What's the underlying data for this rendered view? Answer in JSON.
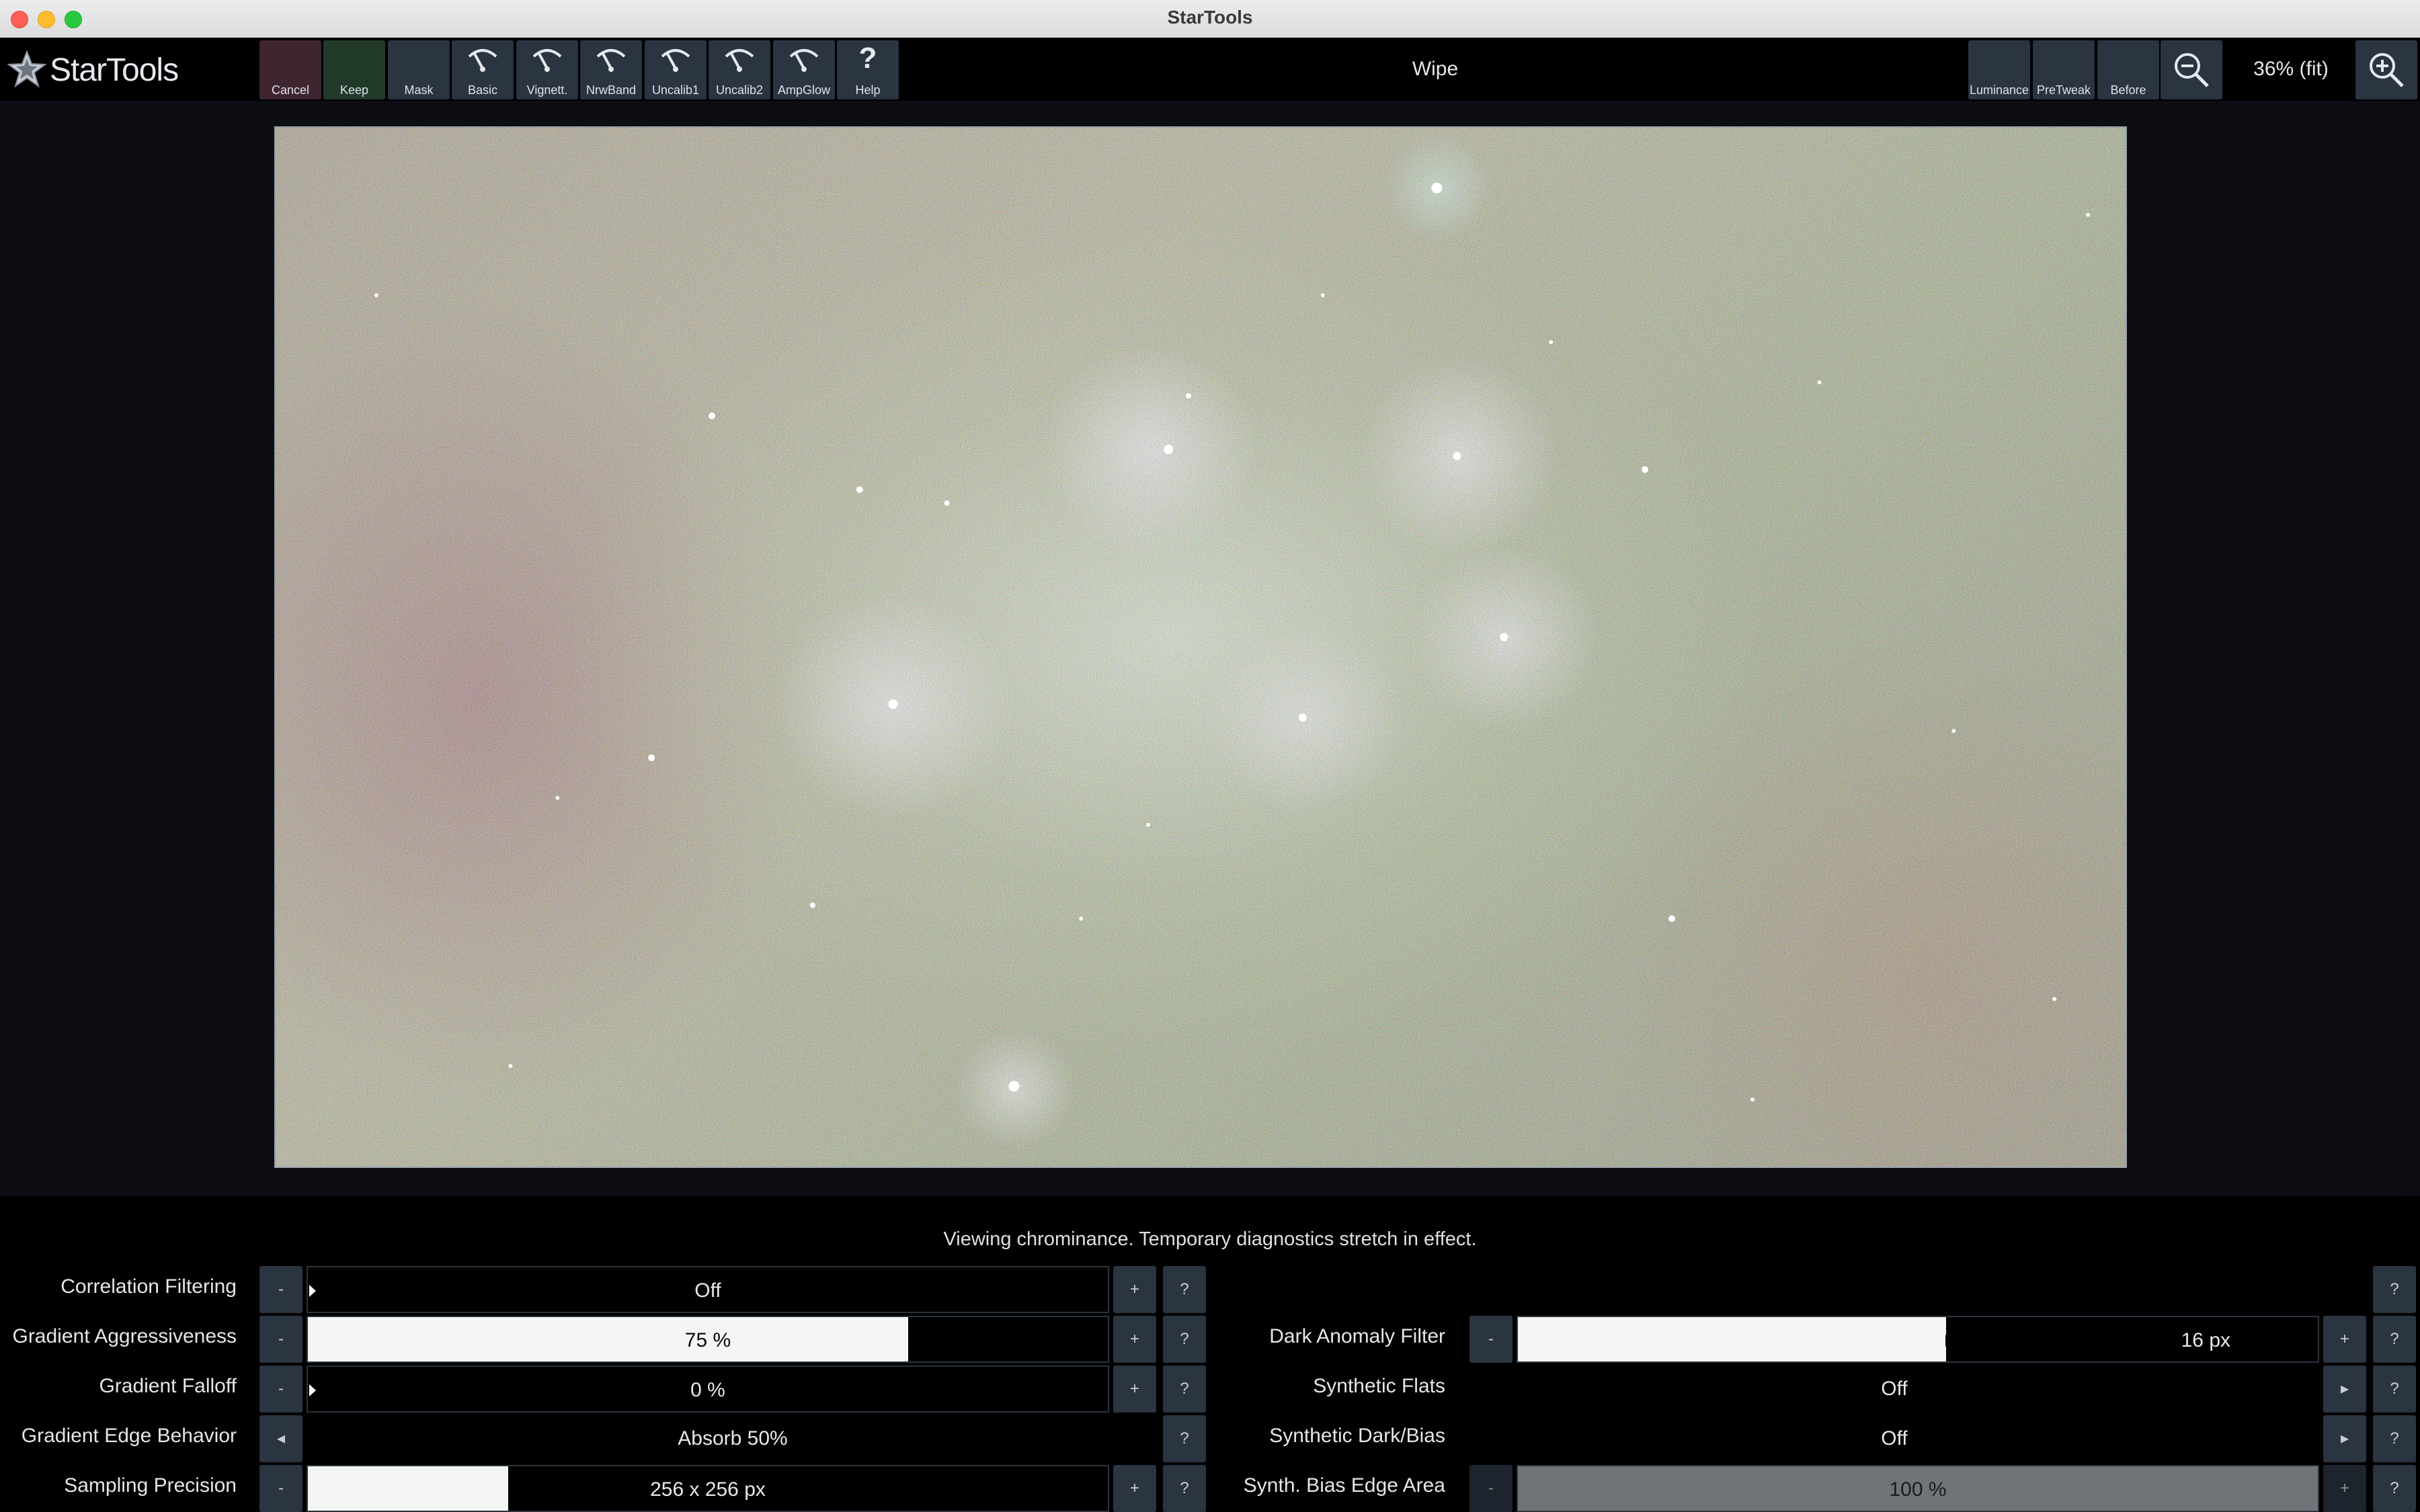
{
  "window": {
    "title": "StarTools"
  },
  "toolbar": {
    "logo_text": "StarTools",
    "left_buttons": [
      "Cancel",
      "Keep",
      "Mask",
      "Basic",
      "Vignett.",
      "NrwBand",
      "Uncalib1",
      "Uncalib2",
      "AmpGlow",
      "Help"
    ],
    "tool_title": "Wipe",
    "right_buttons": [
      "Luminance",
      "PreTweak",
      "Before"
    ],
    "zoom_level": "36% (fit)"
  },
  "status": "Viewing chrominance. Temporary diagnostics stretch in effect.",
  "params_left": [
    {
      "label": "Correlation Filtering",
      "value": "Off",
      "fill": 0.0
    },
    {
      "label": "Gradient Aggressiveness",
      "value": "75 %",
      "fill": 0.75
    },
    {
      "label": "Gradient Falloff",
      "value": "0 %",
      "fill": 0.0
    },
    {
      "label": "Gradient Edge Behavior",
      "value": "Absorb 50%"
    },
    {
      "label": "Sampling Precision",
      "value": "256 x 256 px",
      "fill": 0.25
    }
  ],
  "params_right": [
    {
      "label": "Dark Anomaly Filter",
      "value": "16 px",
      "fill": 0.535
    },
    {
      "label": "Synthetic Flats",
      "value": "Off"
    },
    {
      "label": "Synthetic Dark/Bias",
      "value": "Off"
    },
    {
      "label": "Synth. Bias Edge Area",
      "value": "100 %",
      "fill": 1.0
    }
  ],
  "glyphs": {
    "minus": "-",
    "plus": "+",
    "help": "?",
    "arrow_left": "◂",
    "arrow_right": "▸"
  },
  "colors": {
    "cancel": "#3e2530",
    "keep": "#223a2a",
    "button": "#2b3441",
    "background": "#000000"
  },
  "icons": [
    "star-logo-icon",
    "wiper-icon",
    "help-icon",
    "zoom-out-icon",
    "zoom-in-icon"
  ]
}
